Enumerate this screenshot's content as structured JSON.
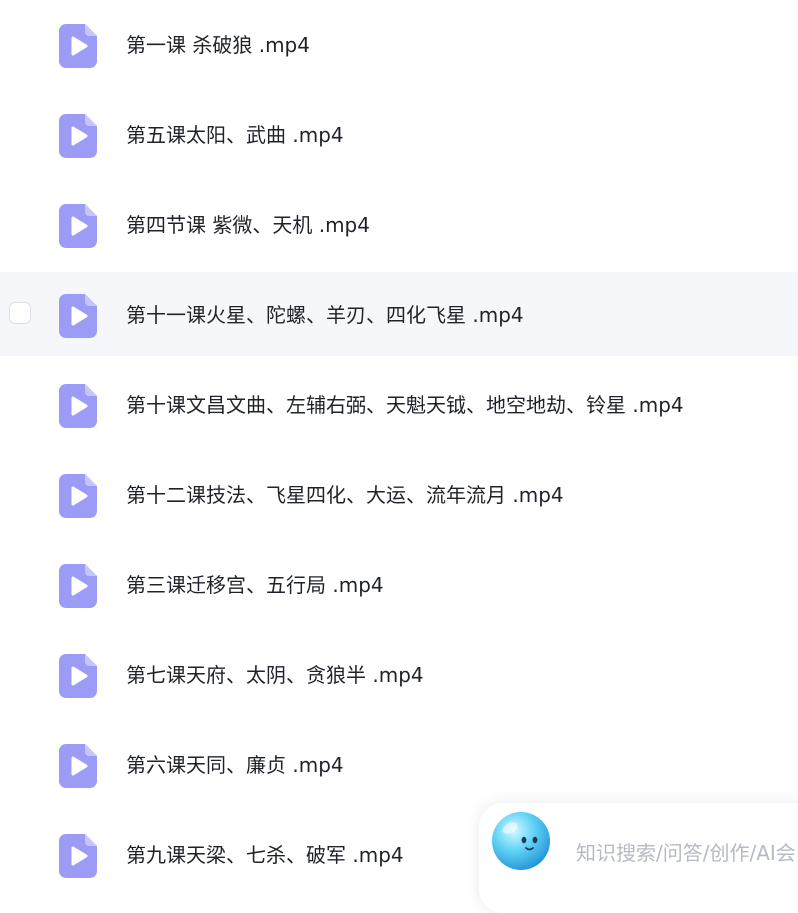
{
  "files": [
    {
      "name": "第一课 杀破狼 .mp4",
      "type_icon": "video-file-icon"
    },
    {
      "name": "第五课太阳、武曲 .mp4",
      "type_icon": "video-file-icon"
    },
    {
      "name": "第四节课 紫微、天机 .mp4",
      "type_icon": "video-file-icon"
    },
    {
      "name": "第十一课火星、陀螺、羊刃、四化飞星 .mp4",
      "type_icon": "video-file-icon",
      "hovered": true,
      "checked": false
    },
    {
      "name": "第十课文昌文曲、左辅右弼、天魁天钺、地空地劫、铃星 .mp4",
      "type_icon": "video-file-icon"
    },
    {
      "name": "第十二课技法、飞星四化、大运、流年流月 .mp4",
      "type_icon": "video-file-icon"
    },
    {
      "name": "第三课迁移宫、五行局 .mp4",
      "type_icon": "video-file-icon"
    },
    {
      "name": "第七课天府、太阴、贪狼半 .mp4",
      "type_icon": "video-file-icon"
    },
    {
      "name": "第六课天同、廉贞 .mp4",
      "type_icon": "video-file-icon"
    },
    {
      "name": "第九课天梁、七杀、破军 .mp4",
      "type_icon": "video-file-icon"
    }
  ],
  "assistant": {
    "placeholder": "知识搜索/问答/创作/AI会",
    "mascot_icon": "ai-assistant-mascot-icon"
  },
  "colors": {
    "video_icon": "#9c9cf6",
    "hover_row": "#f6f7fb",
    "file_text": "#1f2329",
    "placeholder_text": "#b6bac6"
  }
}
